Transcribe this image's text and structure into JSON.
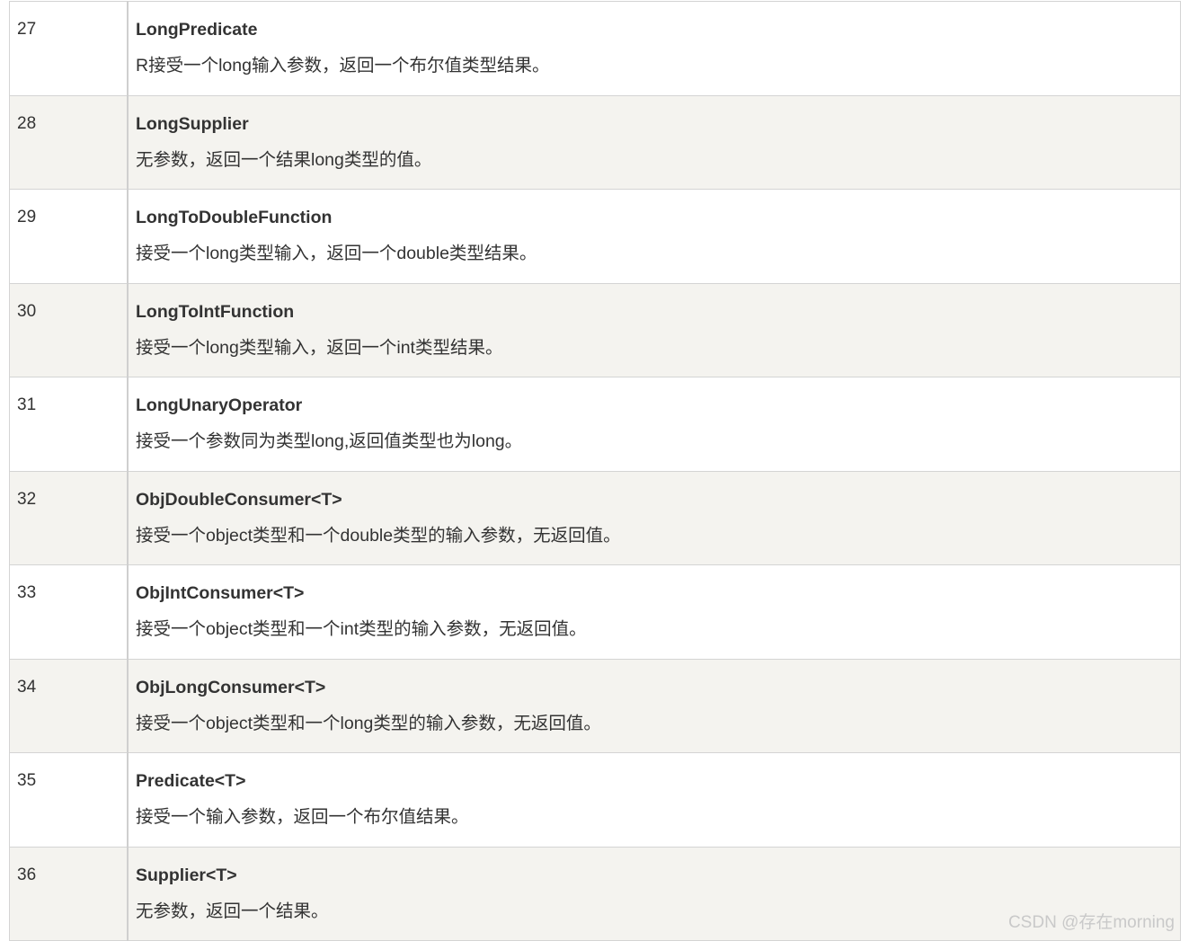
{
  "rows": [
    {
      "num": "27",
      "name": "LongPredicate",
      "desc": "R接受一个long输入参数，返回一个布尔值类型结果。"
    },
    {
      "num": "28",
      "name": "LongSupplier",
      "desc": "无参数，返回一个结果long类型的值。"
    },
    {
      "num": "29",
      "name": "LongToDoubleFunction",
      "desc": "接受一个long类型输入，返回一个double类型结果。"
    },
    {
      "num": "30",
      "name": "LongToIntFunction",
      "desc": "接受一个long类型输入，返回一个int类型结果。"
    },
    {
      "num": "31",
      "name": "LongUnaryOperator",
      "desc": "接受一个参数同为类型long,返回值类型也为long。"
    },
    {
      "num": "32",
      "name": "ObjDoubleConsumer<T>",
      "desc": "接受一个object类型和一个double类型的输入参数，无返回值。"
    },
    {
      "num": "33",
      "name": "ObjIntConsumer<T>",
      "desc": "接受一个object类型和一个int类型的输入参数，无返回值。"
    },
    {
      "num": "34",
      "name": "ObjLongConsumer<T>",
      "desc": "接受一个object类型和一个long类型的输入参数，无返回值。"
    },
    {
      "num": "35",
      "name": "Predicate<T>",
      "desc": "接受一个输入参数，返回一个布尔值结果。"
    },
    {
      "num": "36",
      "name": "Supplier<T>",
      "desc": "无参数，返回一个结果。"
    }
  ],
  "watermark": "CSDN @存在morning",
  "colors": {
    "row_alt_bg": "#f4f3ef",
    "row_bg": "#ffffff",
    "text": "#333333",
    "border": "#d4d4d4"
  }
}
